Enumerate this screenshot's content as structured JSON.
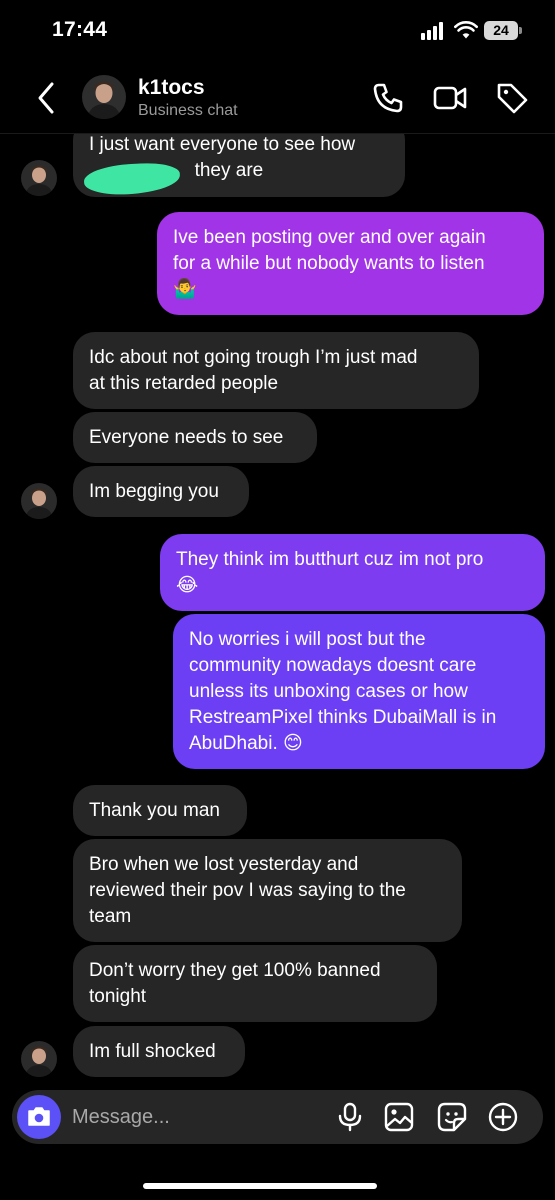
{
  "status_bar": {
    "time": "17:44",
    "battery": "24"
  },
  "header": {
    "contact_name": "k1tocs",
    "subtitle": "Business chat",
    "icons": [
      "back-icon",
      "phone-icon",
      "video-icon",
      "tag-icon"
    ]
  },
  "messages": [
    {
      "direction": "in",
      "text": "I just want everyone to see how\n                    they are"
    },
    {
      "direction": "out",
      "text": "Ive been posting over and over again\nfor a while but nobody wants to listen\n🤷‍♂️"
    },
    {
      "direction": "in",
      "text": "Idc about not going trough I’m just mad\nat this retarded people"
    },
    {
      "direction": "in",
      "text": "Everyone needs to see"
    },
    {
      "direction": "in",
      "text": "Im begging you"
    },
    {
      "direction": "out",
      "text": "They think im butthurt cuz im not pro\n😂"
    },
    {
      "direction": "out",
      "text": "No worries i will post but the\ncommunity nowadays doesnt care\nunless its unboxing cases or how\nRestreamPixel thinks DubaiMall is in\nAbuDhabi. 😊"
    },
    {
      "direction": "in",
      "text": "Thank you man"
    },
    {
      "direction": "in",
      "text": "Bro when we lost yesterday and\nreviewed their pov I was saying to the\nteam"
    },
    {
      "direction": "in",
      "text": "Don’t worry they get 100% banned\ntonight"
    },
    {
      "direction": "in",
      "text": "Im full shocked"
    }
  ],
  "composer": {
    "placeholder": "Message...",
    "icons": [
      "camera-icon",
      "microphone-icon",
      "image-icon",
      "sticker-icon",
      "plus-icon"
    ]
  },
  "colors": {
    "background": "#000000",
    "incoming_bubble": "#262626",
    "outgoing_top": "#a134e6",
    "outgoing_bottom": "#6c3ff5",
    "camera_button": "#5b51f6",
    "redaction": "#3fe6a3"
  }
}
